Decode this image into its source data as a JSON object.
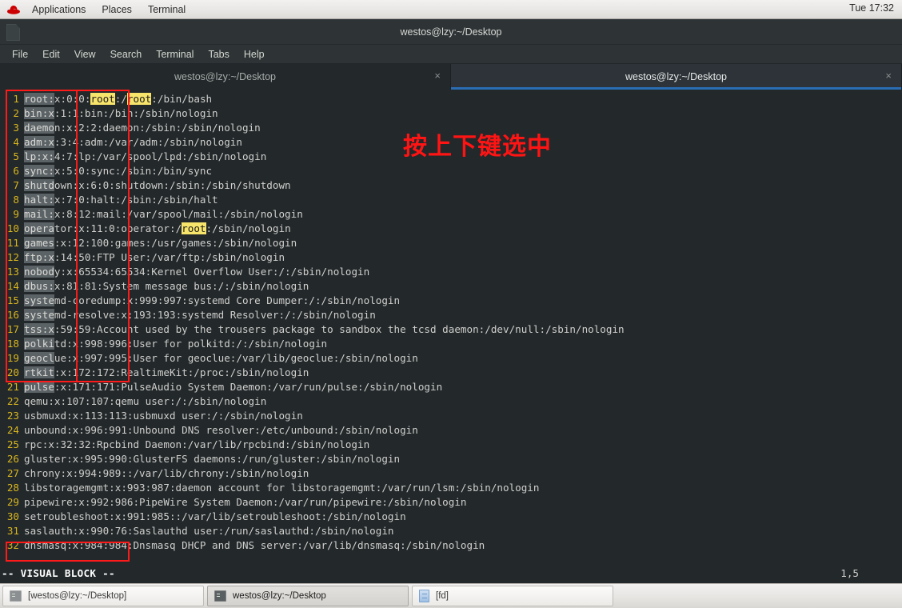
{
  "top_panel": {
    "logo": "redhat-logo",
    "items": [
      "Applications",
      "Places",
      "Terminal"
    ],
    "clock": "Tue 17:32"
  },
  "window": {
    "title": "westos@lzy:~/Desktop",
    "menu": [
      "File",
      "Edit",
      "View",
      "Search",
      "Terminal",
      "Tabs",
      "Help"
    ],
    "tabs": [
      {
        "label": "westos@lzy:~/Desktop",
        "active": false,
        "close": "×"
      },
      {
        "label": "westos@lzy:~/Desktop",
        "active": true,
        "close": "×"
      }
    ]
  },
  "editor": {
    "lines": [
      {
        "n": "1",
        "sel": "root:",
        "rest_pre": "x:0:0:",
        "hl": "root",
        "rest_post": ":/",
        "hl2": "root",
        "tail": ":/bin/bash"
      },
      {
        "n": "2",
        "sel": "bin:x",
        "plain": ":1:1:bin:/bin:/sbin/nologin"
      },
      {
        "n": "3",
        "sel": "daemo",
        "plain": "n:x:2:2:daemon:/sbin:/sbin/nologin"
      },
      {
        "n": "4",
        "sel": "adm:x",
        "plain": ":3:4:adm:/var/adm:/sbin/nologin"
      },
      {
        "n": "5",
        "sel": "lp:x:",
        "plain": "4:7:lp:/var/spool/lpd:/sbin/nologin"
      },
      {
        "n": "6",
        "sel": "sync:",
        "plain": "x:5:0:sync:/sbin:/bin/sync"
      },
      {
        "n": "7",
        "sel": "shutd",
        "plain": "own:x:6:0:shutdown:/sbin:/sbin/shutdown"
      },
      {
        "n": "8",
        "sel": "halt:",
        "plain": "x:7:0:halt:/sbin:/sbin/halt"
      },
      {
        "n": "9",
        "sel": "mail:",
        "plain": "x:8:12:mail:/var/spool/mail:/sbin/nologin"
      },
      {
        "n": "10",
        "sel": "opera",
        "rest_pre": "tor:x:11:0:operator:/",
        "hl": "root",
        "tail": ":/sbin/nologin"
      },
      {
        "n": "11",
        "sel": "games",
        "plain": ":x:12:100:games:/usr/games:/sbin/nologin"
      },
      {
        "n": "12",
        "sel": "ftp:x",
        "plain": ":14:50:FTP User:/var/ftp:/sbin/nologin"
      },
      {
        "n": "13",
        "sel": "nobod",
        "plain": "y:x:65534:65534:Kernel Overflow User:/:/sbin/nologin"
      },
      {
        "n": "14",
        "sel": "dbus:",
        "plain": "x:81:81:System message bus:/:/sbin/nologin"
      },
      {
        "n": "15",
        "sel": "syste",
        "plain": "md-coredump:x:999:997:systemd Core Dumper:/:/sbin/nologin"
      },
      {
        "n": "16",
        "sel": "syste",
        "plain": "md-resolve:x:193:193:systemd Resolver:/:/sbin/nologin"
      },
      {
        "n": "17",
        "sel": "tss:x",
        "plain": ":59:59:Account used by the trousers package to sandbox the tcsd daemon:/dev/null:/sbin/nologin"
      },
      {
        "n": "18",
        "sel": "polki",
        "plain": "td:x:998:996:User for polkitd:/:/sbin/nologin"
      },
      {
        "n": "19",
        "sel": "geocl",
        "plain": "ue:x:997:995:User for geoclue:/var/lib/geoclue:/sbin/nologin"
      },
      {
        "n": "20",
        "sel": "rtkit",
        "plain": ":x:172:172:RealtimeKit:/proc:/sbin/nologin"
      },
      {
        "n": "21",
        "sel": "pulse",
        "plain": ":x:171:171:PulseAudio System Daemon:/var/run/pulse:/sbin/nologin"
      },
      {
        "n": "22",
        "plain": "qemu:x:107:107:qemu user:/:/sbin/nologin"
      },
      {
        "n": "23",
        "plain": "usbmuxd:x:113:113:usbmuxd user:/:/sbin/nologin"
      },
      {
        "n": "24",
        "plain": "unbound:x:996:991:Unbound DNS resolver:/etc/unbound:/sbin/nologin"
      },
      {
        "n": "25",
        "plain": "rpc:x:32:32:Rpcbind Daemon:/var/lib/rpcbind:/sbin/nologin"
      },
      {
        "n": "26",
        "plain": "gluster:x:995:990:GlusterFS daemons:/run/gluster:/sbin/nologin"
      },
      {
        "n": "27",
        "plain": "chrony:x:994:989::/var/lib/chrony:/sbin/nologin"
      },
      {
        "n": "28",
        "plain": "libstoragemgmt:x:993:987:daemon account for libstoragemgmt:/var/run/lsm:/sbin/nologin"
      },
      {
        "n": "29",
        "plain": "pipewire:x:992:986:PipeWire System Daemon:/var/run/pipewire:/sbin/nologin"
      },
      {
        "n": "30",
        "plain": "setroubleshoot:x:991:985::/var/lib/setroubleshoot:/sbin/nologin"
      },
      {
        "n": "31",
        "plain": "saslauth:x:990:76:Saslauthd user:/run/saslauthd:/sbin/nologin"
      },
      {
        "n": "32",
        "plain": "dnsmasq:x:984:984:Dnsmasq DHCP and DNS server:/var/lib/dnsmasq:/sbin/nologin"
      }
    ],
    "mode_text": "-- VISUAL BLOCK --",
    "ruler": "1,5"
  },
  "annotations": {
    "chinese_note": "按上下键选中",
    "color": "#ff1414"
  },
  "taskbar": {
    "items": [
      {
        "label": "[westos@lzy:~/Desktop]",
        "icon": "terminal-icon",
        "active": false
      },
      {
        "label": "westos@lzy:~/Desktop",
        "icon": "terminal-icon",
        "active": true
      },
      {
        "label": "[fd]",
        "icon": "files-icon",
        "active": false
      }
    ]
  }
}
